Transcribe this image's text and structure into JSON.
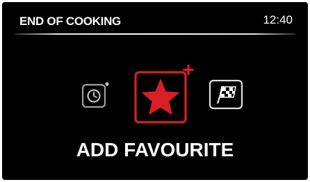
{
  "header": {
    "title": "END OF COOKING",
    "time": "12:40"
  },
  "options": [
    {
      "name": "timer",
      "icon": "timer-clock-icon",
      "selected": false
    },
    {
      "name": "add-favourite",
      "icon": "star-plus-icon",
      "selected": true
    },
    {
      "name": "finish",
      "icon": "checkered-flag-icon",
      "selected": false
    }
  ],
  "selected_label": "ADD FAVOURITE",
  "colors": {
    "background": "#000000",
    "text": "#ffffff",
    "accent": "#d81f26",
    "icon_gray": "#9a9a9a"
  }
}
